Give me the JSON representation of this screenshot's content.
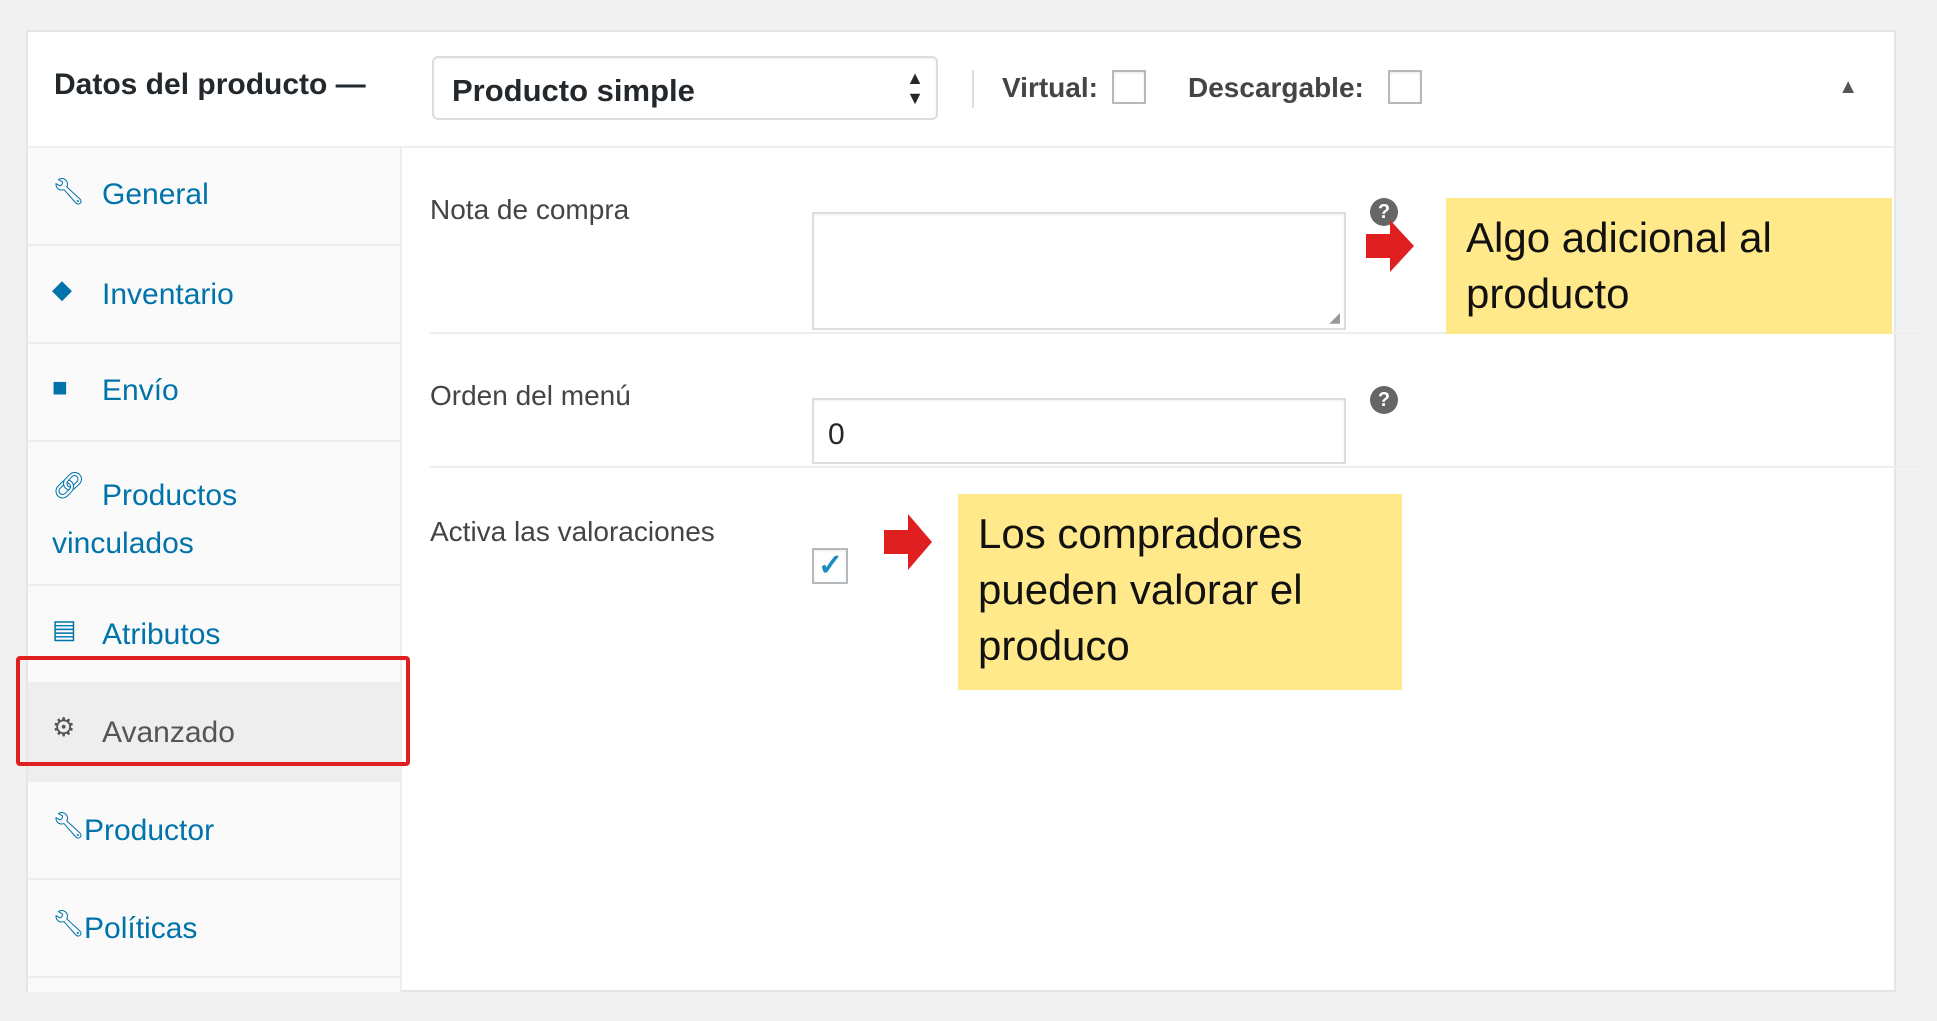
{
  "header": {
    "title": "Datos del producto —",
    "product_type": "Producto simple",
    "virtual_label": "Virtual:",
    "downloadable_label": "Descargable:"
  },
  "sidebar": {
    "items": [
      {
        "label": "General",
        "icon": "wrench-icon"
      },
      {
        "label": "Inventario",
        "icon": "tag-icon"
      },
      {
        "label": "Envío",
        "icon": "truck-icon"
      },
      {
        "label": "Productos vinculados",
        "icon": "link-icon"
      },
      {
        "label": "Atributos",
        "icon": "list-icon"
      },
      {
        "label": "Avanzado",
        "icon": "gear-icon",
        "active": true
      },
      {
        "label": "Productor",
        "icon": "wrench-icon"
      },
      {
        "label": "Políticas",
        "icon": "wrench-icon"
      }
    ]
  },
  "main": {
    "purchase_note_label": "Nota de compra",
    "purchase_note_value": "",
    "menu_order_label": "Orden del menú",
    "menu_order_value": "0",
    "enable_reviews_label": "Activa las valoraciones",
    "enable_reviews_checked": true
  },
  "annotations": {
    "note1": "Algo adicional al producto",
    "note2": "Los compradores pueden valorar el produco",
    "highlight_color": "#e02020",
    "note_color": "#ffe98a",
    "accent_color": "#0073aa"
  }
}
